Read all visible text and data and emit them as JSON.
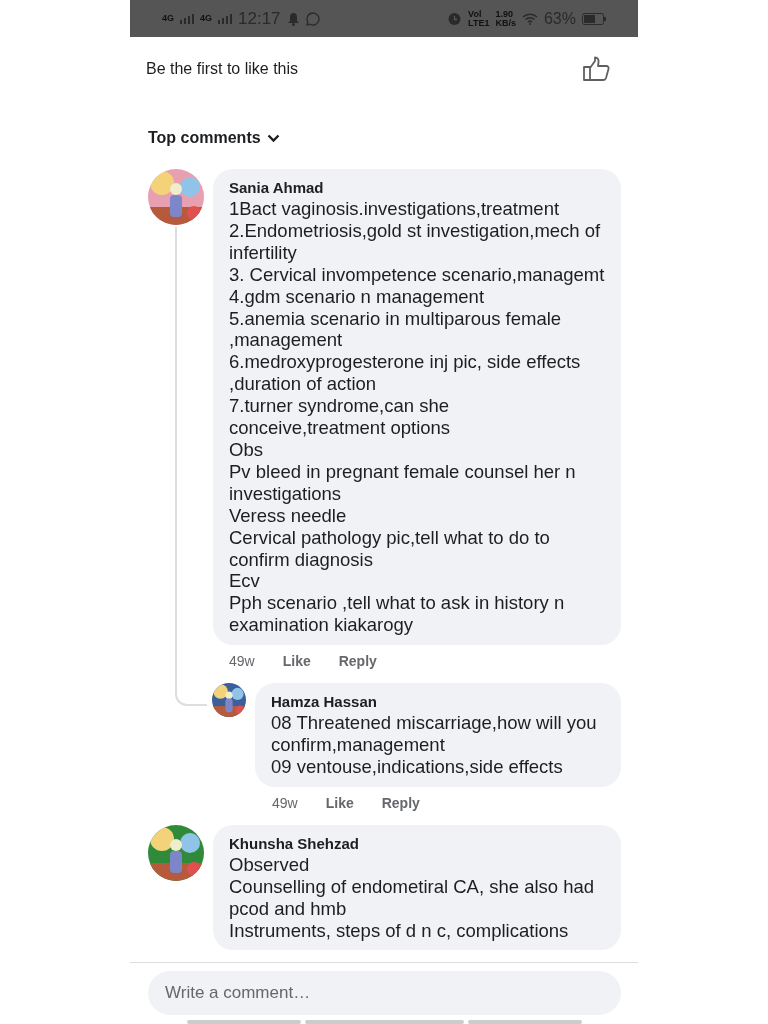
{
  "status_bar": {
    "signals": [
      "4G",
      "4G"
    ],
    "time": "12:17",
    "network": [
      "Vol",
      "LTE1"
    ],
    "speed": [
      "1.90",
      "KB/s"
    ],
    "battery": "63%"
  },
  "likes": {
    "text": "Be the first to like this"
  },
  "sort": {
    "label": "Top comments"
  },
  "comments": [
    {
      "author": "Sania Ahmad",
      "lines": [
        "1Bact vaginosis.investigations,treatment",
        "2.Endometriosis,gold st investigation,mech of infertility",
        "3. Cervical invompetence scenario,managemt",
        "4.gdm scenario n management",
        "5.anemia scenario in multiparous female ,management",
        "6.medroxyprogesterone inj pic, side effects ,duration of action",
        "7.turner syndrome,can she conceive,treatment options",
        "Obs",
        "Pv bleed in pregnant female counsel her n investigations",
        "Veress needle",
        "Cervical pathology pic,tell what to do to confirm  diagnosis",
        "Ecv",
        "Pph scenario ,tell what to ask in history n examination kiakarogy"
      ],
      "time": "49w",
      "like": "Like",
      "reply": "Reply",
      "replies": [
        {
          "author": "Hamza Hassan",
          "lines": [
            "08 Threatened miscarriage,how will you confirm,management",
            "09 ventouse,indications,side effects"
          ],
          "time": "49w",
          "like": "Like",
          "reply": "Reply"
        }
      ]
    },
    {
      "author": "Khunsha Shehzad",
      "lines": [
        "Observed",
        "Counselling of endometiral CA, she also had pcod and hmb",
        "Instruments, steps of d n c, complications"
      ]
    }
  ],
  "composer": {
    "placeholder": "Write a comment…"
  }
}
